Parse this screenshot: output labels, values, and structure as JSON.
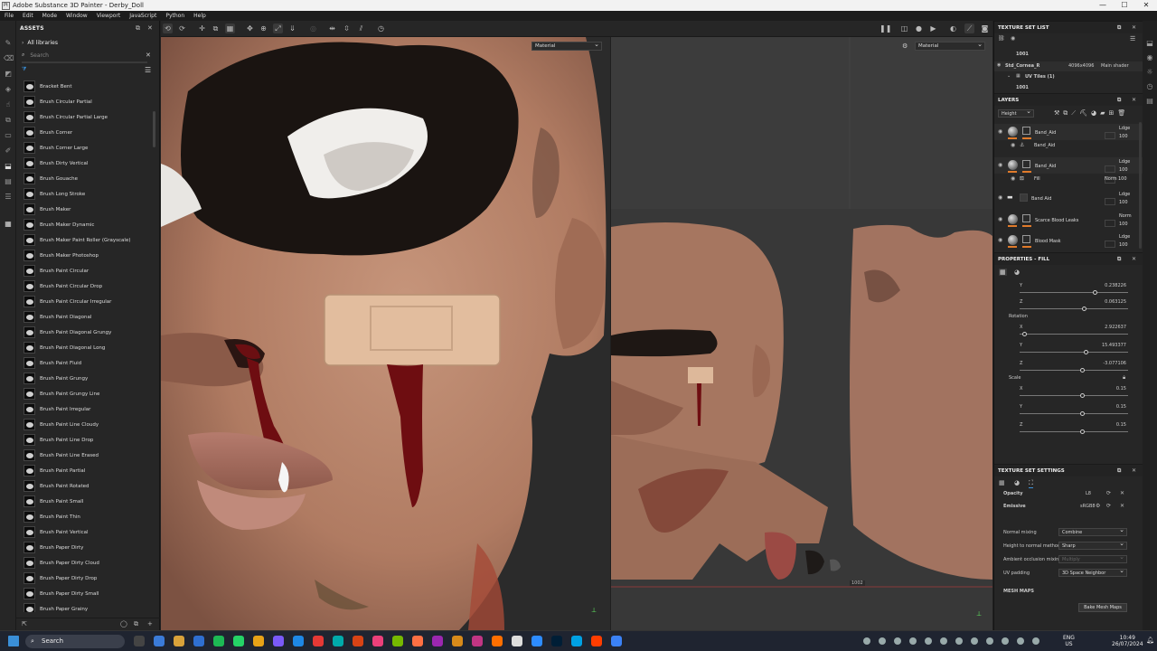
{
  "window": {
    "title": "Adobe Substance 3D Painter - Derby_Doll",
    "app_icon": "Pt"
  },
  "menu": [
    "File",
    "Edit",
    "Mode",
    "Window",
    "Viewport",
    "JavaScript",
    "Python",
    "Help"
  ],
  "assets": {
    "header": "ASSETS",
    "library": "All libraries",
    "search_placeholder": "Search",
    "items": [
      "Bracket Bent",
      "Brush Circular Partial",
      "Brush Circular Partial Large",
      "Brush Corner",
      "Brush Corner Large",
      "Brush Dirty Vertical",
      "Brush Gouache",
      "Brush Long Stroke",
      "Brush Maker",
      "Brush Maker Dynamic",
      "Brush Maker Paint Roller (Grayscale)",
      "Brush Maker Photoshop",
      "Brush Paint Circular",
      "Brush Paint Circular Drop",
      "Brush Paint Circular Irregular",
      "Brush Paint Diagonal",
      "Brush Paint Diagonal Grungy",
      "Brush Paint Diagonal Long",
      "Brush Paint Fluid",
      "Brush Paint Grungy",
      "Brush Paint Grungy Line",
      "Brush Paint Irregular",
      "Brush Paint Line Cloudy",
      "Brush Paint Line Drop",
      "Brush Paint Line Erased",
      "Brush Paint Partial",
      "Brush Paint Rotated",
      "Brush Paint Small",
      "Brush Paint Thin",
      "Brush Paint Vertical",
      "Brush Paper Dirty",
      "Brush Paper Dirty Cloud",
      "Brush Paper Dirty Drop",
      "Brush Paper Dirty Small",
      "Brush Paper Grainy"
    ]
  },
  "viewport": {
    "mode_3d": "Material",
    "mode_2d": "Material",
    "uv_tile_label": "1002"
  },
  "texture_set_list": {
    "header": "TEXTURE SET LIST",
    "tile_top": "1001",
    "set_name": "Std_Cornea_R",
    "set_res": "4096x4096",
    "set_shader": "Main shader",
    "uv_tiles": "UV Tiles (1)",
    "tile_bottom": "1001"
  },
  "layers": {
    "header": "LAYERS",
    "channel": "Height",
    "rows": [
      {
        "name": "Band_Aid",
        "blend": "Ldge",
        "opacity": "100"
      },
      {
        "name": "Band_Aid",
        "sub": true
      },
      {
        "name": "Band_Aid",
        "blend": "Ldge",
        "opacity": "100"
      },
      {
        "name": "Fill",
        "fill": true,
        "blend": "Norm",
        "opacity": "100"
      },
      {
        "name": "Band Aid",
        "folder": true,
        "blend": "Ldge",
        "opacity": "100"
      },
      {
        "name": "Scarce Blood Leaks",
        "blend": "Norm",
        "opacity": "100"
      },
      {
        "name": "Blood Mask",
        "blend": "Ldge",
        "opacity": "100"
      }
    ]
  },
  "properties": {
    "header": "PROPERTIES - FILL",
    "offset": {
      "y": "0.238226",
      "z": "0.063125",
      "y_level": 0.7,
      "z_level": 0.6
    },
    "rotation_label": "Rotation",
    "rotation": {
      "x": "2.922637",
      "y": "15.493377",
      "z": "-3.077106",
      "x_level": 0.05,
      "y_level": 0.62,
      "z_level": 0.58
    },
    "scale_label": "Scale",
    "scale": {
      "x": "0.15",
      "y": "0.15",
      "z": "0.15",
      "x_level": 0.58,
      "y_level": 0.58,
      "z_level": 0.58
    }
  },
  "texture_set_settings": {
    "header": "TEXTURE SET SETTINGS",
    "opacity_label": "Opacity",
    "opacity_fmt": "L8",
    "emissive_label": "Emissive",
    "emissive_fmt": "sRGB8",
    "normal_mixing_label": "Normal mixing",
    "normal_mixing": "Combine",
    "h2n_label": "Height to normal method",
    "h2n": "Sharp",
    "ao_mixing_label": "Ambient occlusion mixing",
    "ao_mixing": "Multiply",
    "uv_padding_label": "UV padding",
    "uv_padding": "3D Space Neighbor",
    "mesh_maps": "MESH MAPS",
    "bake_button": "Bake Mesh Maps"
  },
  "taskbar": {
    "search": "Search",
    "lang_top": "ENG",
    "lang_bottom": "US",
    "time": "10:49",
    "date": "26/07/2024"
  },
  "colors": {
    "accent_orange": "#e07a2a",
    "accent_blue": "#3a8fd8",
    "panel": "#262626"
  }
}
